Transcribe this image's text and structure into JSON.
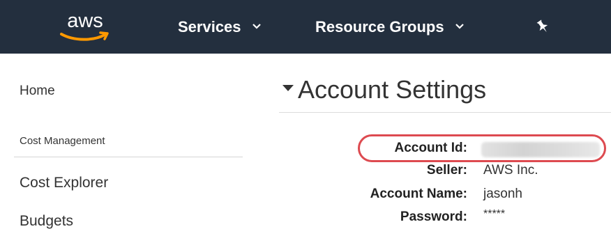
{
  "topnav": {
    "logo_text": "aws",
    "services_label": "Services",
    "resource_groups_label": "Resource Groups",
    "pin_icon": "pin-icon",
    "chevron_icon": "chevron-down-icon"
  },
  "sidebar": {
    "home_label": "Home",
    "section_heading": "Cost Management",
    "items": [
      {
        "label": "Cost Explorer"
      },
      {
        "label": "Budgets"
      }
    ]
  },
  "main": {
    "title": "Account Settings",
    "title_icon": "caret-down-icon",
    "fields": [
      {
        "label": "Account Id:",
        "value": ""
      },
      {
        "label": "Seller:",
        "value": "AWS Inc."
      },
      {
        "label": "Account Name:",
        "value": "jasonh"
      },
      {
        "label": "Password:",
        "value": "*****"
      }
    ]
  },
  "colors": {
    "nav_background": "#232f3e",
    "logo_smile": "#ff9900",
    "annotation_oval": "#dd4a50"
  }
}
